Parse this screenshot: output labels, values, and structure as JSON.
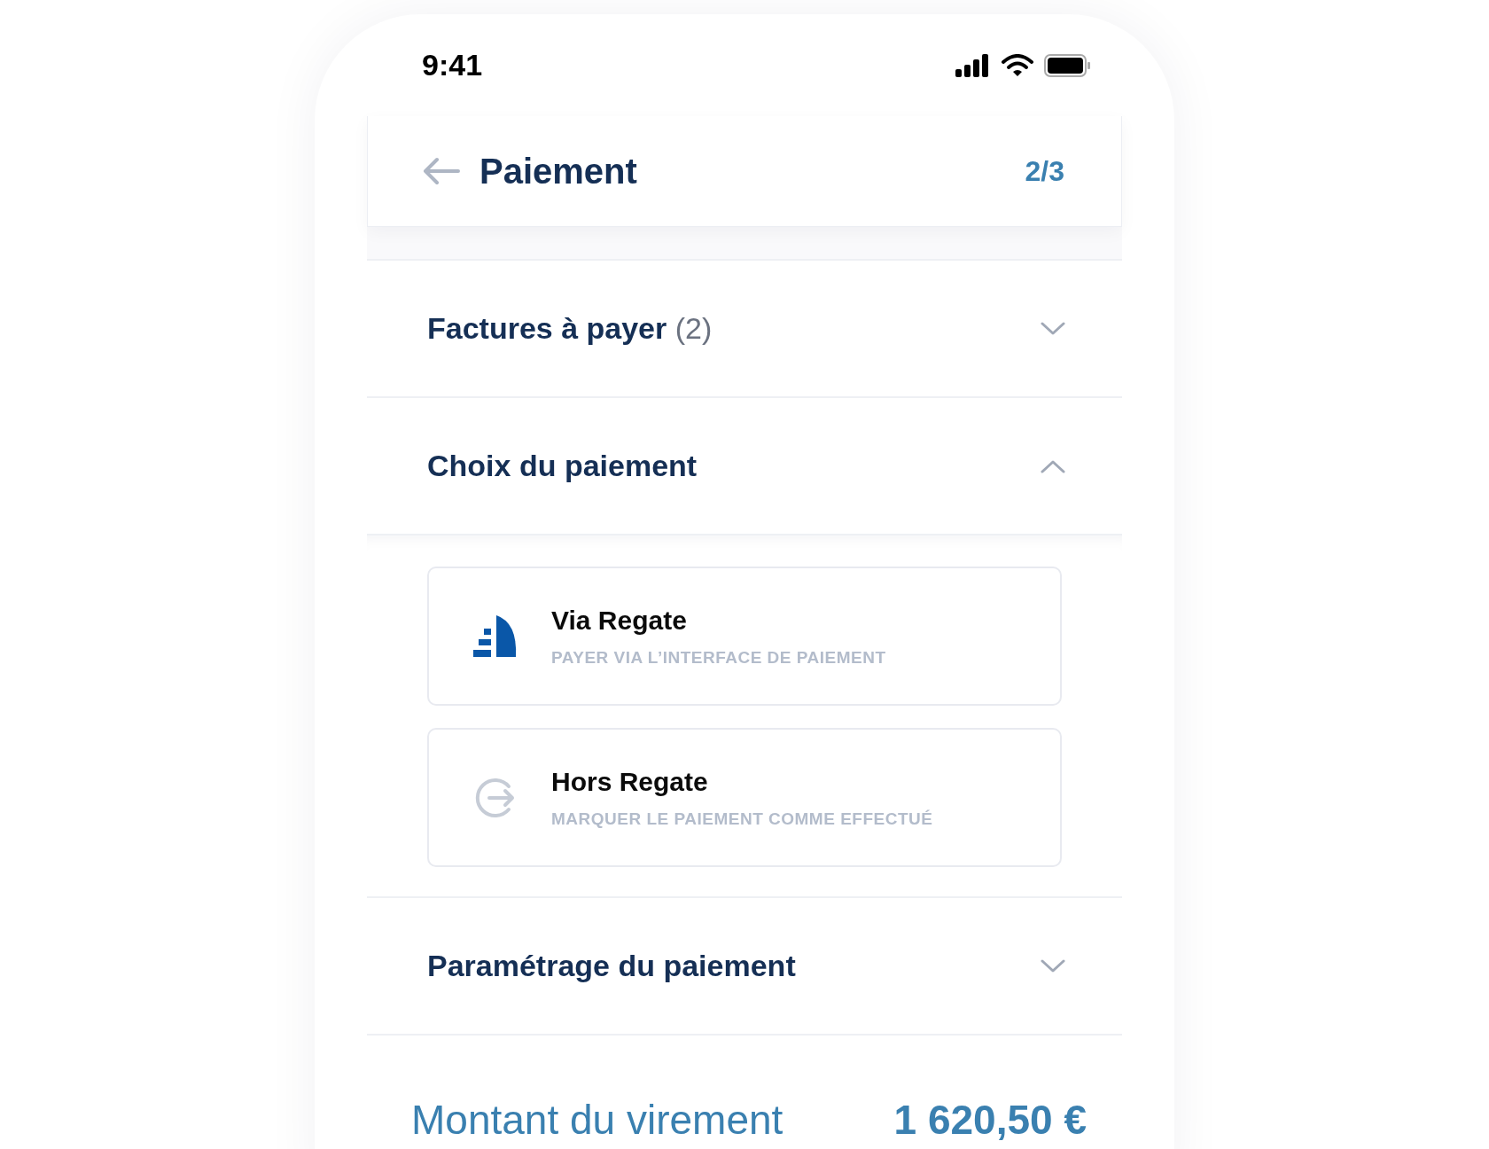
{
  "status_bar": {
    "time": "9:41"
  },
  "header": {
    "title": "Paiement",
    "step": "2/3"
  },
  "sections": [
    {
      "title": "Factures à payer",
      "count": "(2)",
      "expanded": false
    },
    {
      "title": "Choix du paiement",
      "expanded": true,
      "options": [
        {
          "kind": "regate",
          "title": "Via Regate",
          "subtitle": "PAYER VIA L’INTERFACE DE PAIEMENT"
        },
        {
          "kind": "external",
          "title": "Hors Regate",
          "subtitle": "MARQUER LE PAIEMENT COMME EFFECTUÉ"
        }
      ]
    },
    {
      "title": "Paramétrage du paiement",
      "expanded": false
    }
  ],
  "total": {
    "label": "Montant du virement",
    "amount": "1 620,50 €"
  }
}
